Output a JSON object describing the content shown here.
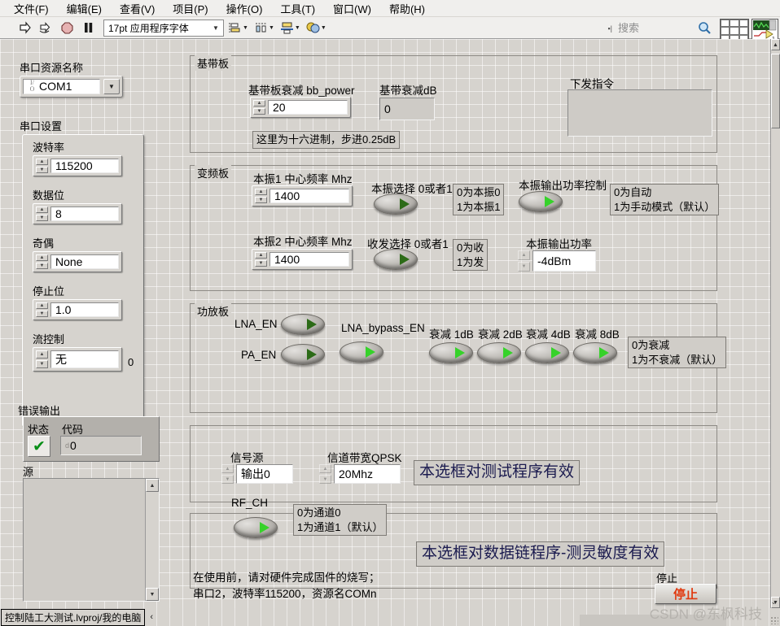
{
  "menu": {
    "items": [
      "文件(F)",
      "编辑(E)",
      "查看(V)",
      "项目(P)",
      "操作(O)",
      "工具(T)",
      "窗口(W)",
      "帮助(H)"
    ]
  },
  "toolbar": {
    "run_icon": "run-arrow-icon",
    "run_continuous_icon": "run-continuous-icon",
    "abort_icon": "abort-stop-icon",
    "pause_icon": "pause-icon",
    "font_label": "17pt 应用程序字体",
    "align_icon": "align-objects-icon",
    "distribute_icon": "distribute-objects-icon",
    "resize_icon": "resize-objects-icon",
    "reorder_icon": "reorder-objects-icon",
    "search_placeholder": "搜索",
    "search_value": "",
    "search_icon": "magnifier-icon",
    "help_icon": "question-mark-icon"
  },
  "sidebar": {
    "visa_label": "串口资源名称",
    "visa_value": "COM1",
    "settings_label": "串口设置",
    "fields": [
      {
        "label": "波特率",
        "value": "115200"
      },
      {
        "label": "数据位",
        "value": "8"
      },
      {
        "label": "奇偶",
        "value": "None"
      },
      {
        "label": "停止位",
        "value": "1.0"
      },
      {
        "label": "流控制",
        "value": "无",
        "suffix": "0"
      }
    ],
    "error_label": "错误输出",
    "error_status_label": "状态",
    "error_code_label": "代码",
    "error_code_value": "0",
    "error_source_label": "源",
    "error_source_value": ""
  },
  "baseband": {
    "title": "基带板",
    "power_label": "基带板衰减 bb_power",
    "power_value": "20",
    "atten_label": "基带衰减dB",
    "atten_value": "0",
    "note": "这里为十六进制，步进0.25dB"
  },
  "command": {
    "label": "下发指令",
    "value": ""
  },
  "converter": {
    "title": "变频板",
    "lo1_label": "本振1 中心频率 Mhz",
    "lo1_value": "1400",
    "lo2_label": "本振2 中心频率 Mhz",
    "lo2_value": "1400",
    "lo_select_label": "本振选择 0或者1",
    "lo_select_note": "0为本振0\n1为本振1",
    "txrx_select_label": "收发选择 0或者1",
    "txrx_select_note": "0为收\n1为发",
    "lo_pwr_ctrl_label": "本振输出功率控制",
    "lo_pwr_ctrl_note": "0为自动\n1为手动模式（默认）",
    "lo_pwr_label": "本振输出功率",
    "lo_pwr_value": "-4dBm"
  },
  "amplifier": {
    "title": "功放板",
    "lna_en_label": "LNA_EN",
    "pa_en_label": "PA_EN",
    "lna_bypass_label": "LNA_bypass_EN",
    "atten_switches": [
      "衰减 1dB",
      "衰减 2dB",
      "衰减 4dB",
      "衰减 8dB"
    ],
    "atten_note": "0为衰减\n1为不衰减（默认）"
  },
  "signal": {
    "source_label": "信号源",
    "source_value": "输出0",
    "bandwidth_label": "信道带宽QPSK",
    "bandwidth_value": "20Mhz",
    "note": "本选框对测试程序有效"
  },
  "rf": {
    "ch_label": "RF_CH",
    "ch_note": "0为通道0\n1为通道1（默认）",
    "note": "本选框对数据链程序-测灵敏度有效"
  },
  "footer": {
    "notes": "在使用前，请对硬件完成固件的烧写；\n串口2，波特率115200，资源名COMn",
    "stop_label": "停止",
    "stop_button": "停止"
  },
  "statusbar": {
    "project": "控制陆工大测试.lvproj/我的电脑",
    "watermark": "CSDN @东枫科技"
  }
}
